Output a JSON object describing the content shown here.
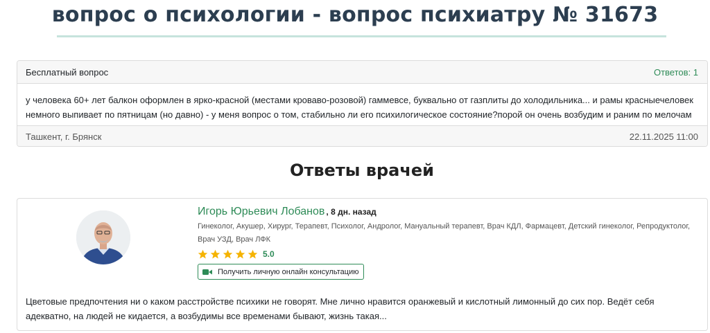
{
  "page": {
    "title": "вопрос о психологии - вопрос психиатру № 31673"
  },
  "question": {
    "type_label": "Бесплатный вопрос",
    "answers_count": "Ответов: 1",
    "text": "у человека 60+ лет балкон оформлен в ярко-красной (местами кроваво-розовой) гаммевсе, буквально от газплиты до холодильника... и рамы красныечеловек немного выпивает по пятницам (но давно) - у меня вопрос о том, стабильно ли его психилогическое состояние?порой он очень возбудим и раним по мелочам",
    "location": "Ташкент, г. Брянск",
    "datetime": "22.11.2025 11:00"
  },
  "answers_section": {
    "heading": "Ответы врачей"
  },
  "answer": {
    "doctor_name": "Игорь Юрьевич Лобанов",
    "time_ago": ", 8 дн. назад",
    "specialties": "Гинеколог, Акушер, Хирург, Терапевт, Психолог, Андролог, Мануальный терапевт, Врач КДЛ, Фармацевт, Детский гинеколог, Репродуктолог, Врач УЗД, Врач ЛФК",
    "rating": "5.0",
    "stars": 5,
    "consult_button": "Получить личную онлайн консультацию",
    "text": "Цветовые предпочтения ни о каком расстройстве психики не говорят. Мне лично нравится оранжевый и кислотный лимонный до сих пор. Ведёт себя адекватно, на людей не кидается, а возбудимы все временами бывают, жизнь такая..."
  },
  "colors": {
    "accent_green": "#2e8b57",
    "title": "#2c3e50",
    "star": "#f5b301"
  }
}
